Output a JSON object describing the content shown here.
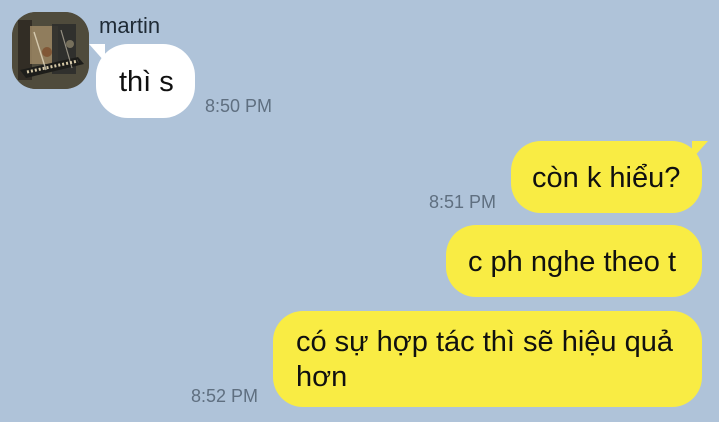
{
  "conversation": {
    "participant_name": "martin",
    "avatar_icon": "profile-photo-icon"
  },
  "messages": [
    {
      "direction": "incoming",
      "text": "thì s",
      "time": "8:50 PM"
    },
    {
      "direction": "outgoing",
      "text": "còn k hiểu?",
      "time": "8:51 PM"
    },
    {
      "direction": "outgoing",
      "text": "c ph nghe theo t",
      "time": ""
    },
    {
      "direction": "outgoing",
      "text": "có sự hợp tác thì sẽ hiệu quả hơn",
      "time": "8:52 PM"
    }
  ],
  "colors": {
    "background": "#afc3d9",
    "incoming_bubble": "#ffffff",
    "outgoing_bubble": "#f9ec44",
    "timestamp": "#5f6f80"
  }
}
